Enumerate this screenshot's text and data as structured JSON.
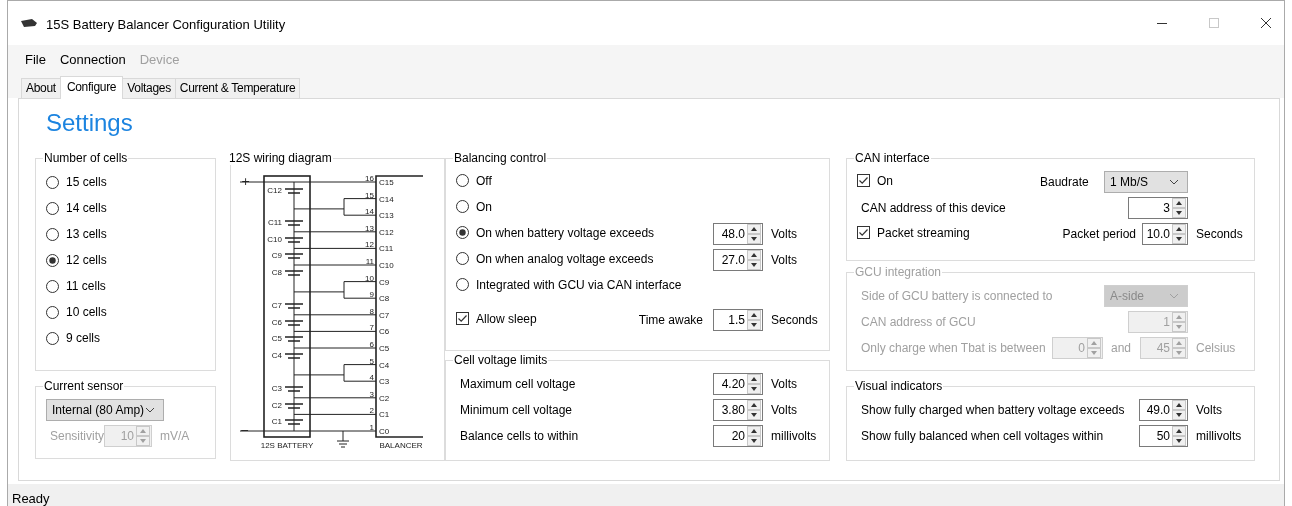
{
  "window": {
    "title": "15S Battery Balancer Configuration Utility"
  },
  "menu": [
    {
      "label": "File",
      "disabled": false
    },
    {
      "label": "Connection",
      "disabled": false
    },
    {
      "label": "Device",
      "disabled": true
    }
  ],
  "tabs": [
    {
      "label": "About",
      "selected": false
    },
    {
      "label": "Configure",
      "selected": true
    },
    {
      "label": "Voltages",
      "selected": false
    },
    {
      "label": "Current & Temperature",
      "selected": false
    }
  ],
  "heading": "Settings",
  "cells_group": {
    "title": "Number of cells",
    "options": [
      {
        "label": "15 cells",
        "selected": false
      },
      {
        "label": "14 cells",
        "selected": false
      },
      {
        "label": "13 cells",
        "selected": false
      },
      {
        "label": "12 cells",
        "selected": true
      },
      {
        "label": "11 cells",
        "selected": false
      },
      {
        "label": "10 cells",
        "selected": false
      },
      {
        "label": "9 cells",
        "selected": false
      }
    ]
  },
  "current_sensor": {
    "title": "Current sensor",
    "sensor": "Internal (80 Amp)",
    "sensitivity": {
      "label": "Sensitivity",
      "value": "10",
      "unit": "mV/A",
      "disabled": true
    }
  },
  "diagram": {
    "title": "12S wiring diagram",
    "plus_sign": "+",
    "minus_sign": "−",
    "battery_label": "12S BATTERY",
    "balancer_label": "BALANCER",
    "cells": [
      "C12",
      "C11",
      "C10",
      "C9",
      "C8",
      "C7",
      "C6",
      "C5",
      "C4",
      "C3",
      "C2",
      "C1"
    ],
    "pins": [
      {
        "number": "16",
        "label": "C15"
      },
      {
        "number": "15",
        "label": "C14"
      },
      {
        "number": "14",
        "label": "C13"
      },
      {
        "number": "13",
        "label": "C12"
      },
      {
        "number": "12",
        "label": "C11"
      },
      {
        "number": "11",
        "label": "C10"
      },
      {
        "number": "10",
        "label": "C9"
      },
      {
        "number": "9",
        "label": "C8"
      },
      {
        "number": "8",
        "label": "C7"
      },
      {
        "number": "7",
        "label": "C6"
      },
      {
        "number": "6",
        "label": "C5"
      },
      {
        "number": "5",
        "label": "C4"
      },
      {
        "number": "4",
        "label": "C3"
      },
      {
        "number": "3",
        "label": "C2"
      },
      {
        "number": "2",
        "label": "C1"
      },
      {
        "number": "1",
        "label": "C0"
      }
    ]
  },
  "balancing": {
    "title": "Balancing control",
    "options": [
      {
        "label": "Off",
        "selected": false
      },
      {
        "label": "On",
        "selected": false
      },
      {
        "label": "On when battery voltage exceeds",
        "selected": true,
        "value": "48.0",
        "unit": "Volts"
      },
      {
        "label": "On when analog voltage exceeds",
        "selected": false,
        "value": "27.0",
        "unit": "Volts"
      },
      {
        "label": "Integrated with GCU via CAN interface",
        "selected": false
      }
    ],
    "allow_sleep": {
      "label": "Allow sleep",
      "checked": true
    },
    "time_awake": {
      "label": "Time awake",
      "value": "1.5",
      "unit": "Seconds"
    }
  },
  "limits": {
    "title": "Cell voltage limits",
    "rows": [
      {
        "label": "Maximum cell voltage",
        "value": "4.20",
        "unit": "Volts"
      },
      {
        "label": "Minimum cell voltage",
        "value": "3.80",
        "unit": "Volts"
      },
      {
        "label": "Balance cells to within",
        "value": "20",
        "unit": "millivolts"
      }
    ]
  },
  "can": {
    "title": "CAN interface",
    "on": {
      "label": "On",
      "checked": true
    },
    "baudrate": {
      "label": "Baudrate",
      "value": "1 Mb/S"
    },
    "address": {
      "label": "CAN address of this device",
      "value": "3"
    },
    "streaming": {
      "label": "Packet streaming",
      "checked": true
    },
    "period": {
      "label": "Packet period",
      "value": "10.0",
      "unit": "Seconds"
    }
  },
  "gcu": {
    "title": "GCU integration",
    "disabled": true,
    "side": {
      "label": "Side of GCU battery is connected to",
      "value": "A-side"
    },
    "address": {
      "label": "CAN address of GCU",
      "value": "1"
    },
    "temp": {
      "label": "Only charge when Tbat is between",
      "min": "0",
      "conjunction": "and",
      "max": "45",
      "unit": "Celsius"
    }
  },
  "visual": {
    "title": "Visual indicators",
    "rows": [
      {
        "label": "Show fully charged when battery voltage exceeds",
        "value": "49.0",
        "unit": "Volts"
      },
      {
        "label": "Show fully balanced when cell voltages within",
        "value": "50",
        "unit": "millivolts"
      }
    ]
  },
  "status_bar": {
    "text": "Ready"
  }
}
